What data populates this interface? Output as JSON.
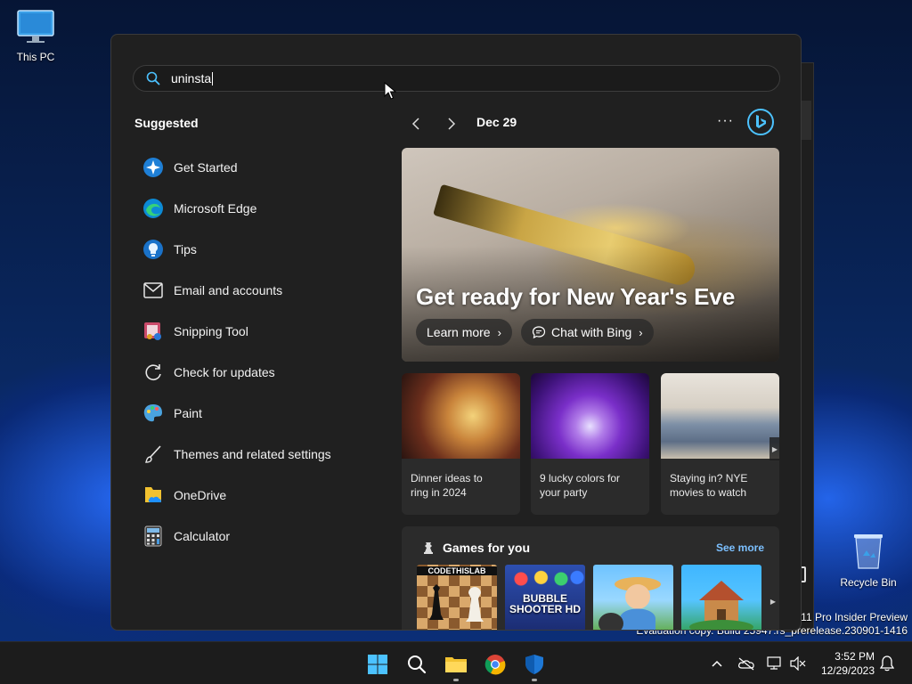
{
  "desktop": {
    "icons": [
      {
        "label": "This PC"
      },
      {
        "label": "Recycle Bin"
      }
    ],
    "watermark": {
      "line1": "s 11 Pro Insider Preview",
      "line2": "Evaluation copy. Build 25947.rs_prerelease.230901-1416"
    }
  },
  "start_menu": {
    "search": {
      "value": "uninsta",
      "icon": "search-icon"
    },
    "suggested_title": "Suggested",
    "suggested": [
      {
        "label": "Get Started",
        "icon": "get-started-icon"
      },
      {
        "label": "Microsoft Edge",
        "icon": "edge-icon"
      },
      {
        "label": "Tips",
        "icon": "tips-icon"
      },
      {
        "label": "Email and accounts",
        "icon": "mail-icon"
      },
      {
        "label": "Snipping Tool",
        "icon": "snipping-tool-icon"
      },
      {
        "label": "Check for updates",
        "icon": "refresh-icon"
      },
      {
        "label": "Paint",
        "icon": "paint-icon"
      },
      {
        "label": "Themes and related settings",
        "icon": "brush-icon"
      },
      {
        "label": "OneDrive",
        "icon": "onedrive-icon"
      },
      {
        "label": "Calculator",
        "icon": "calculator-icon"
      }
    ],
    "feed": {
      "date": "Dec 29",
      "more_label": "···",
      "hero": {
        "title": "Get ready for New Year's Eve",
        "learn_more": "Learn more",
        "chat_with_bing": "Chat with Bing"
      },
      "cards": [
        {
          "caption_line1": "Dinner ideas to",
          "caption_line2": "ring in 2024"
        },
        {
          "caption_line1": "9 lucky colors for",
          "caption_line2": "your party"
        },
        {
          "caption_line1": "Staying in? NYE",
          "caption_line2": "movies to watch"
        }
      ],
      "games": {
        "title": "Games for you",
        "see_more": "See more",
        "tiles": [
          {
            "label": "CODETHISLAB"
          },
          {
            "label": "BUBBLE SHOOTER HD"
          },
          {
            "label": ""
          },
          {
            "label": ""
          }
        ]
      }
    }
  },
  "taskbar": {
    "time": "3:52 PM",
    "date": "12/29/2023",
    "chevron": "^"
  },
  "colors": {
    "accent_blue": "#4cc2ff",
    "link_blue": "#7cc0ff",
    "menu_bg": "#202020",
    "card_bg": "#2b2b2b"
  }
}
